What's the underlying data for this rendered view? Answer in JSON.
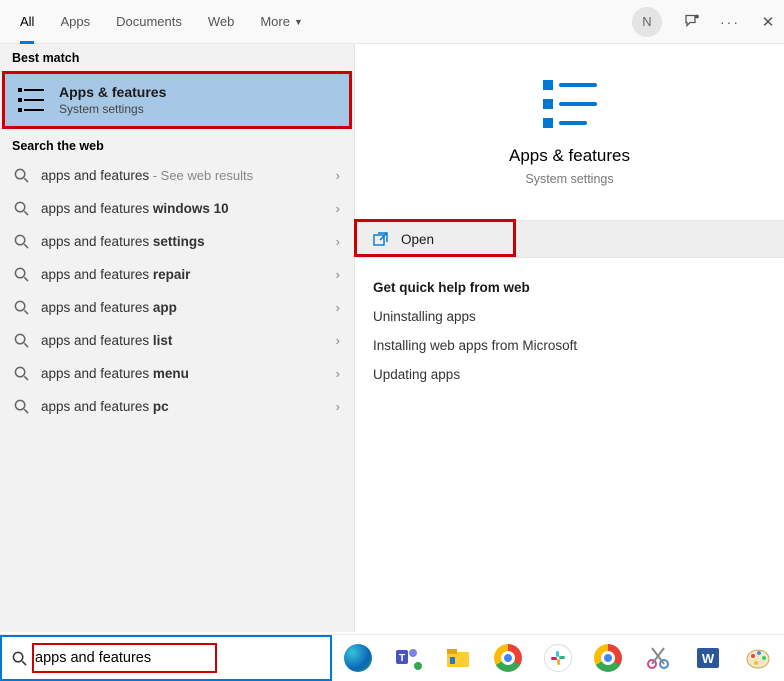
{
  "topbar": {
    "tabs": [
      "All",
      "Apps",
      "Documents",
      "Web",
      "More"
    ],
    "avatar_letter": "N"
  },
  "left": {
    "best_match_label": "Best match",
    "best_match": {
      "title": "Apps & features",
      "subtitle": "System settings"
    },
    "web_label": "Search the web",
    "web_items": [
      {
        "prefix": "apps and features",
        "bold": "",
        "suffix": " - See web results",
        "gray": true
      },
      {
        "prefix": "apps and features ",
        "bold": "windows 10"
      },
      {
        "prefix": "apps and features ",
        "bold": "settings"
      },
      {
        "prefix": "apps and features ",
        "bold": "repair"
      },
      {
        "prefix": "apps and features ",
        "bold": "app"
      },
      {
        "prefix": "apps and features ",
        "bold": "list"
      },
      {
        "prefix": "apps and features ",
        "bold": "menu"
      },
      {
        "prefix": "apps and features ",
        "bold": "pc"
      }
    ]
  },
  "right": {
    "title": "Apps & features",
    "subtitle": "System settings",
    "open_label": "Open",
    "help_head": "Get quick help from web",
    "help_links": [
      "Uninstalling apps",
      "Installing web apps from Microsoft",
      "Updating apps"
    ]
  },
  "search": {
    "value": "apps and features"
  },
  "taskbar_icons": [
    "edge",
    "teams",
    "files",
    "chrome",
    "slack",
    "chrome2",
    "snip",
    "word",
    "paint"
  ]
}
